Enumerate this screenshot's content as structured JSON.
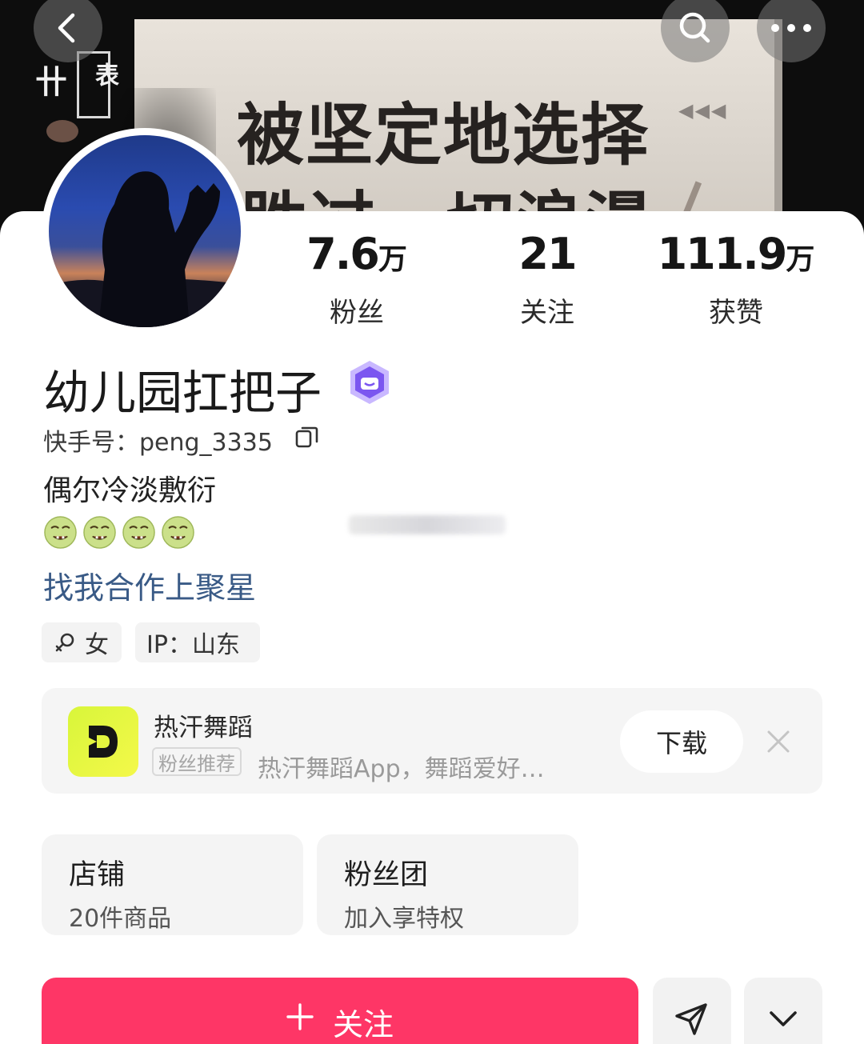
{
  "cover": {
    "line1": "被坚定地选择",
    "line2": "胜过一切浪漫",
    "side_glyph": "卄",
    "side_glyph2": "表"
  },
  "stats": [
    {
      "value": "7.6",
      "unit": "万",
      "label": "粉丝"
    },
    {
      "value": "21",
      "unit": "",
      "label": "关注"
    },
    {
      "value": "111.9",
      "unit": "万",
      "label": "获赞"
    }
  ],
  "profile": {
    "name": "幼儿园扛把子",
    "kuaishou_id": "快手号：peng_3335",
    "bio": "偶尔冷淡敷衍",
    "emoji_icon": "drooling-face-icon",
    "coop_link": "找我合作上聚星"
  },
  "tags": {
    "gender": "女",
    "ip": "IP：山东"
  },
  "ad": {
    "title": "热汗舞蹈",
    "tag": "粉丝推荐",
    "desc": "热汗舞蹈App，舞蹈爱好…",
    "download": "下载"
  },
  "entries": {
    "shop_title": "店铺",
    "shop_sub": "20件商品",
    "fans_title": "粉丝团",
    "fans_sub": "加入享特权"
  },
  "actions": {
    "follow": "关注"
  },
  "colors": {
    "follow_button": "#fe3666",
    "link": "#395a86",
    "ad_logo": "#e4f63f"
  }
}
